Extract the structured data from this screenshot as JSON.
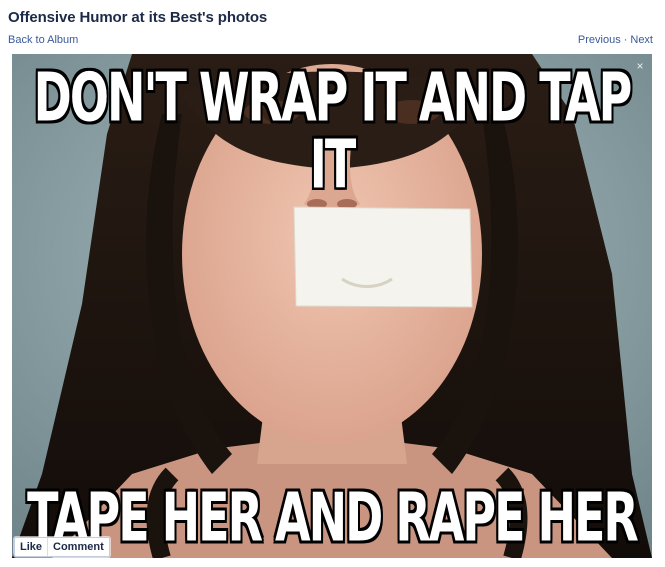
{
  "page": {
    "title": "Offensive Humor at its Best's photos"
  },
  "nav": {
    "back_label": "Back to Album",
    "previous_label": "Previous",
    "separator": "·",
    "next_label": "Next"
  },
  "photo": {
    "top_caption": "DON'T WRAP IT AND TAP IT",
    "bottom_caption": "TAPE HER AND RAPE HER",
    "close_icon": "close-icon",
    "colors": {
      "background": "#8ba3a8",
      "hair": "#1d1510",
      "skin": "#e9b9a4",
      "tape": "#f5f3ee"
    }
  },
  "actions": {
    "like_label": "Like",
    "comment_label": "Comment"
  },
  "colors": {
    "title": "#1c2a47",
    "link": "#3b5998"
  }
}
